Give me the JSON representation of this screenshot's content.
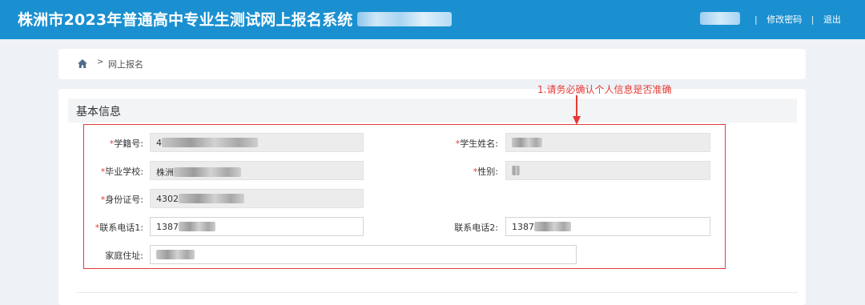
{
  "header": {
    "title": "株洲市2023年普通高中专业生测试网上报名系统",
    "change_password": "修改密码",
    "separator": "|",
    "logout": "退出"
  },
  "breadcrumb": {
    "arrow": ">",
    "current": "网上报名"
  },
  "annotation": "1.请务必确认个人信息是否准确",
  "section": {
    "title": "基本信息"
  },
  "form": {
    "student_id": {
      "label": "学籍号:",
      "required_mark": "*",
      "value": "4"
    },
    "student_name": {
      "label": "学生姓名:",
      "required_mark": "*",
      "value": ""
    },
    "school": {
      "label": "毕业学校:",
      "required_mark": "*",
      "value": "株洲"
    },
    "gender": {
      "label": "性别:",
      "required_mark": "*",
      "value": ""
    },
    "id_number": {
      "label": "身份证号:",
      "required_mark": "*",
      "value": "4302"
    },
    "phone1": {
      "label": "联系电话1:",
      "required_mark": "*",
      "value": "1387"
    },
    "phone2": {
      "label": "联系电话2:",
      "value": "1387"
    },
    "address": {
      "label": "家庭住址:",
      "value": ""
    }
  },
  "colors": {
    "header_bg": "#1a90d0",
    "annotation_red": "#e53935",
    "page_bg": "#eef1f5"
  },
  "icons": {
    "home": "home-icon",
    "annotation_arrow": "arrow-down-icon"
  }
}
